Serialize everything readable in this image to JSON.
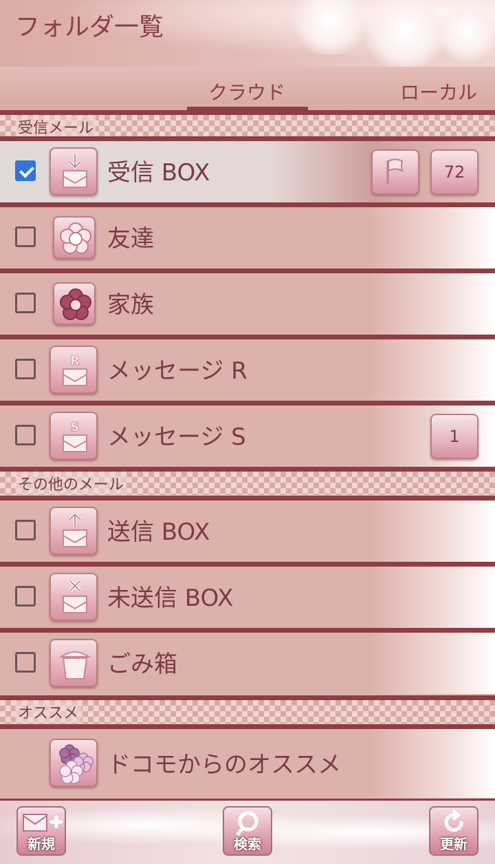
{
  "header": {
    "title": "フォルダ一覧"
  },
  "tabs": [
    {
      "label": "クラウド",
      "active": true
    },
    {
      "label": "ローカル",
      "active": false
    }
  ],
  "sections": {
    "inbox": "受信メール",
    "other": "その他のメール",
    "recommend": "オススメ"
  },
  "folders": [
    {
      "label": "受信 BOX",
      "checked": true,
      "icon": "inbox-icon",
      "badge": "72",
      "flag": true
    },
    {
      "label": "友達",
      "checked": false,
      "icon": "flower-light-icon"
    },
    {
      "label": "家族",
      "checked": false,
      "icon": "flower-dark-icon"
    },
    {
      "label": "メッセージ R",
      "checked": false,
      "icon": "message-r-icon"
    },
    {
      "label": "メッセージ S",
      "checked": false,
      "icon": "message-s-icon",
      "badge": "1"
    },
    {
      "label": "送信 BOX",
      "checked": false,
      "icon": "outbox-icon"
    },
    {
      "label": "未送信 BOX",
      "checked": false,
      "icon": "unsent-icon"
    },
    {
      "label": "ごみ箱",
      "checked": false,
      "icon": "trash-icon"
    },
    {
      "label": "ドコモからのオススメ",
      "icon": "flowers-icon"
    }
  ],
  "toolbar": {
    "new": "新規",
    "search": "検索",
    "refresh": "更新"
  },
  "colors": {
    "accent": "#8e3e44",
    "row_bg": "#deb2ac",
    "text": "#7a3c44",
    "checkbox_checked": "#2f76d8"
  }
}
